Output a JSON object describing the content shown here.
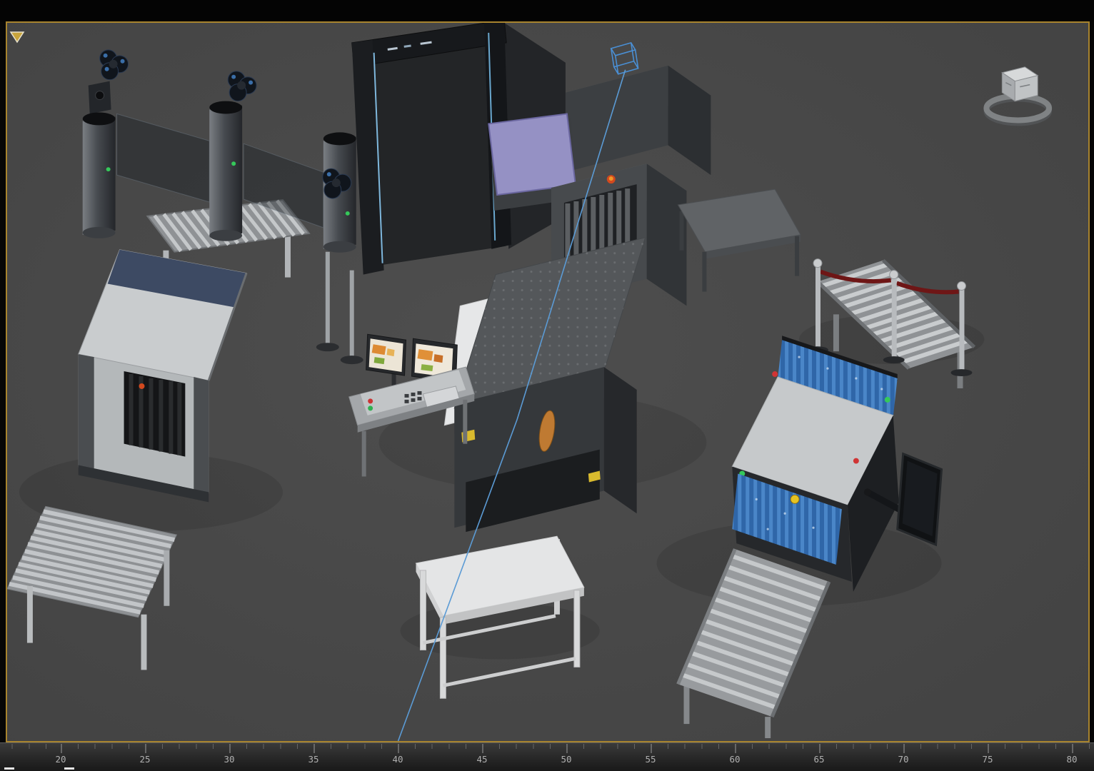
{
  "window": {
    "background": "#060606"
  },
  "viewport": {
    "background": "#4a4a4a",
    "border_color": "#a8842e",
    "label": ""
  },
  "viewcube": {
    "ring_color": "#85888b",
    "cube_color": "#d7d9da"
  },
  "timeline": {
    "ticks": [
      "20",
      "25",
      "30",
      "35",
      "40",
      "45",
      "50",
      "55",
      "60",
      "65",
      "70",
      "75",
      "80"
    ]
  },
  "scene": {
    "colors": {
      "floor": "#4a4a4a",
      "navy_panel": "#3d4a63",
      "purple_panel": "#9591c4",
      "curtain_blue_light": "#4a86c8",
      "curtain_blue_dark": "#2f66a8",
      "spline_blue": "#5b9bd5",
      "rope_red": "#6e1616",
      "warning_yellow": "#d9ba2e",
      "logo_orange": "#d2491e",
      "led_green": "#35c85a",
      "led_red": "#d03434",
      "emergency_yellow": "#e6c322"
    },
    "objects": [
      "turnstile-gate-1",
      "turnstile-gate-2",
      "turnstile-gate-3",
      "glass-panels",
      "walkthrough-metal-detector",
      "xray-scanner-left",
      "infeed-roller-conveyor-left",
      "outfeed-roller-conveyor-left",
      "xray-scanner-center",
      "operator-desk",
      "operator-monitors",
      "packing-table",
      "side-table",
      "inbound-roller-conveyor-right",
      "stanchion-barrier",
      "xray-scanner-right",
      "outbound-roller-conveyor-right",
      "side-monitor-arm",
      "spline-path",
      "dummy-helper",
      "viewcube"
    ]
  }
}
